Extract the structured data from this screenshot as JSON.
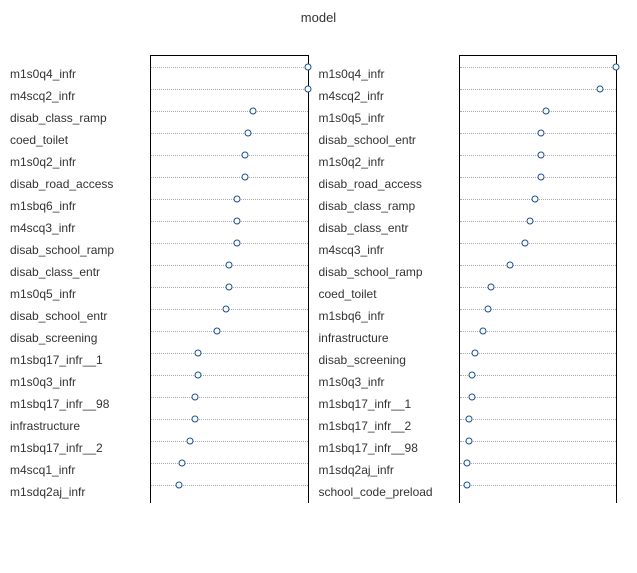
{
  "title": "model",
  "chart_data": [
    {
      "type": "dot",
      "title": "",
      "xlim": [
        0,
        100
      ],
      "series": [
        {
          "label": "m1s0q4_infr",
          "value": 100
        },
        {
          "label": "m4scq2_infr",
          "value": 100
        },
        {
          "label": "disab_class_ramp",
          "value": 65
        },
        {
          "label": "coed_toilet",
          "value": 62
        },
        {
          "label": "m1s0q2_infr",
          "value": 60
        },
        {
          "label": "disab_road_access",
          "value": 60
        },
        {
          "label": "m1sbq6_infr",
          "value": 55
        },
        {
          "label": "m4scq3_infr",
          "value": 55
        },
        {
          "label": "disab_school_ramp",
          "value": 55
        },
        {
          "label": "disab_class_entr",
          "value": 50
        },
        {
          "label": "m1s0q5_infr",
          "value": 50
        },
        {
          "label": "disab_school_entr",
          "value": 48
        },
        {
          "label": "disab_screening",
          "value": 42
        },
        {
          "label": "m1sbq17_infr__1",
          "value": 30
        },
        {
          "label": "m1s0q3_infr",
          "value": 30
        },
        {
          "label": "m1sbq17_infr__98",
          "value": 28
        },
        {
          "label": "infrastructure",
          "value": 28
        },
        {
          "label": "m1sbq17_infr__2",
          "value": 25
        },
        {
          "label": "m4scq1_infr",
          "value": 20
        },
        {
          "label": "m1sdq2aj_infr",
          "value": 18
        }
      ]
    },
    {
      "type": "dot",
      "title": "",
      "xlim": [
        0,
        100
      ],
      "series": [
        {
          "label": "m1s0q4_infr",
          "value": 100
        },
        {
          "label": "m4scq2_infr",
          "value": 90
        },
        {
          "label": "m1s0q5_infr",
          "value": 55
        },
        {
          "label": "disab_school_entr",
          "value": 52
        },
        {
          "label": "m1s0q2_infr",
          "value": 52
        },
        {
          "label": "disab_road_access",
          "value": 52
        },
        {
          "label": "disab_class_ramp",
          "value": 48
        },
        {
          "label": "disab_class_entr",
          "value": 45
        },
        {
          "label": "m4scq3_infr",
          "value": 42
        },
        {
          "label": "disab_school_ramp",
          "value": 32
        },
        {
          "label": "coed_toilet",
          "value": 20
        },
        {
          "label": "m1sbq6_infr",
          "value": 18
        },
        {
          "label": "infrastructure",
          "value": 15
        },
        {
          "label": "disab_screening",
          "value": 10
        },
        {
          "label": "m1s0q3_infr",
          "value": 8
        },
        {
          "label": "m1sbq17_infr__1",
          "value": 8
        },
        {
          "label": "m1sbq17_infr__2",
          "value": 6
        },
        {
          "label": "m1sbq17_infr__98",
          "value": 6
        },
        {
          "label": "m1sdq2aj_infr",
          "value": 5
        },
        {
          "label": "school_code_preload",
          "value": 5
        }
      ]
    }
  ]
}
